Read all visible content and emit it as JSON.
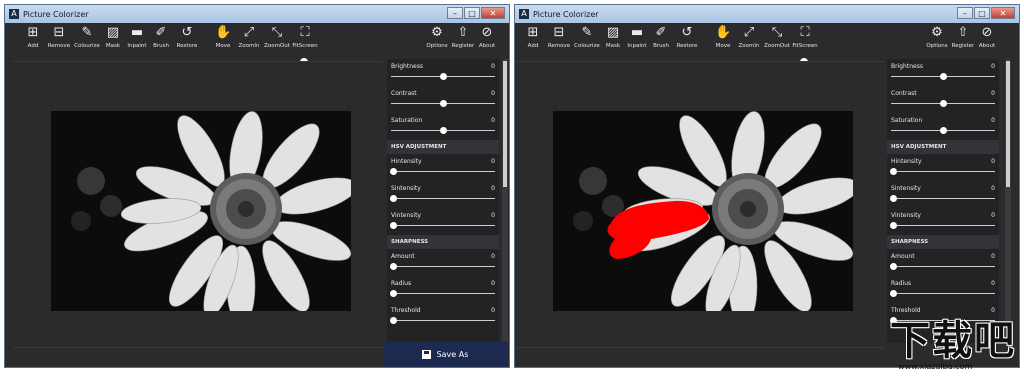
{
  "window": {
    "title": "Picture Colorizer",
    "app_icon": "A",
    "buttons": {
      "minimize": "–",
      "maximize": "□",
      "close": "✕"
    }
  },
  "toolbar": {
    "tools": [
      {
        "label": "Add",
        "icon": "add-icon",
        "glyph": "⊞"
      },
      {
        "label": "Remove",
        "icon": "remove-icon",
        "glyph": "⊟"
      },
      {
        "label": "Colourize",
        "icon": "colourize-icon",
        "glyph": "✎"
      },
      {
        "label": "Mask",
        "icon": "mask-icon",
        "glyph": "▨"
      },
      {
        "label": "Inpaint",
        "icon": "inpaint-icon",
        "glyph": "▬"
      },
      {
        "label": "Brush",
        "icon": "brush-icon",
        "glyph": "✐"
      },
      {
        "label": "Restore",
        "icon": "restore-icon",
        "glyph": "↺"
      },
      {
        "label": "Move",
        "icon": "hand-icon",
        "glyph": "✋"
      },
      {
        "label": "ZoomIn",
        "icon": "zoomin-icon",
        "glyph": "⤢"
      },
      {
        "label": "ZoomOut",
        "icon": "zoomout-icon",
        "glyph": "⤡"
      },
      {
        "label": "FitScreen",
        "icon": "fitscreen-icon",
        "glyph": "⛶"
      },
      {
        "label": "Options",
        "icon": "gear-icon",
        "glyph": "⚙"
      },
      {
        "label": "Register",
        "icon": "register-icon",
        "glyph": "⇧"
      },
      {
        "label": "About",
        "icon": "about-icon",
        "glyph": "⊘"
      }
    ]
  },
  "zoom": {
    "level": 0.1
  },
  "panel": {
    "rows": [
      {
        "type": "slider",
        "label": "Brightness",
        "value": "0",
        "level": 0.5
      },
      {
        "type": "slider",
        "label": "Contrast",
        "value": "0",
        "level": 0.5
      },
      {
        "type": "slider",
        "label": "Saturation",
        "value": "0",
        "level": 0.5
      },
      {
        "type": "section",
        "label": "HSV ADJUSTMENT"
      },
      {
        "type": "slider",
        "label": "Hintensity",
        "value": "0",
        "level": 0.0
      },
      {
        "type": "slider",
        "label": "Sintensity",
        "value": "0",
        "level": 0.0
      },
      {
        "type": "slider",
        "label": "Vintensity",
        "value": "0",
        "level": 0.0
      },
      {
        "type": "section",
        "label": "SHARPNESS"
      },
      {
        "type": "slider",
        "label": "Amount",
        "value": "0",
        "level": 0.0
      },
      {
        "type": "slider",
        "label": "Radius",
        "value": "0",
        "level": 0.0
      },
      {
        "type": "slider",
        "label": "Threshold",
        "value": "0",
        "level": 0.0
      }
    ]
  },
  "save_label": "Save As",
  "watermark": {
    "text": "下载吧",
    "url": "www.xiazaiba.com"
  },
  "colors": {
    "mask": "#ff0000",
    "save_button": "#1d2a4f",
    "background": "#2b2b2e"
  }
}
